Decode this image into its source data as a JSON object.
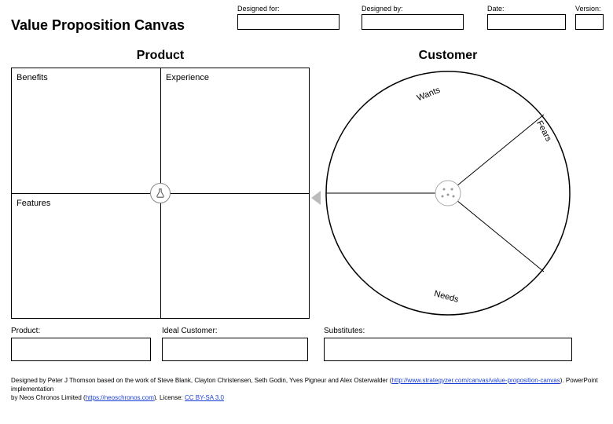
{
  "title": "Value Proposition Canvas",
  "header": {
    "designed_for": {
      "label": "Designed for:",
      "value": ""
    },
    "designed_by": {
      "label": "Designed by:",
      "value": ""
    },
    "date": {
      "label": "Date:",
      "value": ""
    },
    "version": {
      "label": "Version:",
      "value": ""
    }
  },
  "product": {
    "heading": "Product",
    "quads": {
      "benefits": "Benefits",
      "experience": "Experience",
      "features": "Features"
    },
    "center_icon": "flask-icon"
  },
  "customer": {
    "heading": "Customer",
    "segments": {
      "wants": "Wants",
      "fears": "Fears",
      "needs": "Needs"
    },
    "center_icon": "brain-icon"
  },
  "bottom": {
    "product": {
      "label": "Product:",
      "value": ""
    },
    "ideal_customer": {
      "label": "Ideal Customer:",
      "value": ""
    },
    "substitutes": {
      "label": "Substitutes:",
      "value": ""
    }
  },
  "footer": {
    "line1_pre": "Designed by Peter J Thomson based on the work of Steve Blank, Clayton Christensen, Seth Godin, Yves Pigneur and Alex Osterwalder (",
    "line1_link_text": "http://www.strategyzer.com/canvas/value-proposition-canvas",
    "line1_post": "). PowerPoint implementation",
    "line2_pre": "by Neos Chronos Limited (",
    "line2_link_text": "https://neoschronos.com",
    "line2_mid": "). License: ",
    "license_text": "CC BY-SA 3.0"
  }
}
